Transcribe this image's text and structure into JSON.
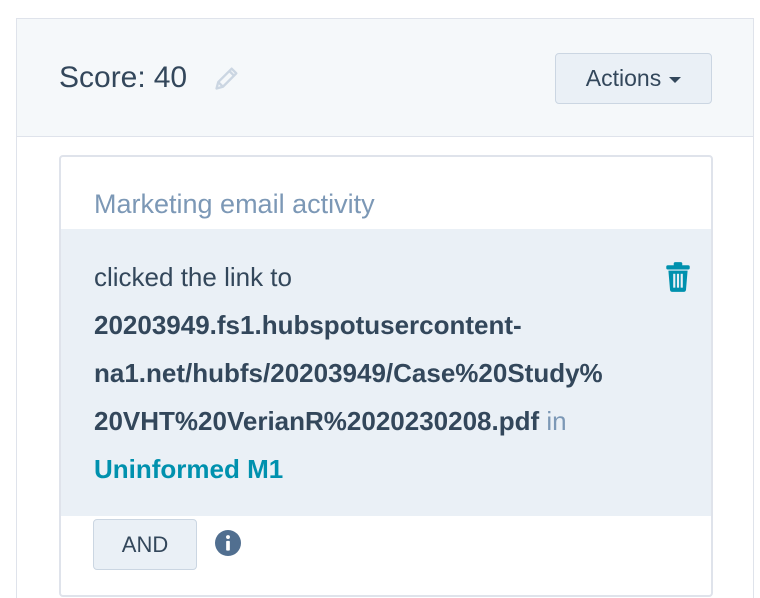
{
  "header": {
    "score_label": "Score:",
    "score_value": "40",
    "edit_icon": "pencil-icon",
    "actions_label": "Actions"
  },
  "filter": {
    "title": "Marketing email activity",
    "action_text": "clicked the link to",
    "url_lines": [
      "20203949.fs1.hubspotusercontent-",
      "na1.net/hubfs/20203949/Case%20Study%",
      "20VHT%20VerianR%2020230208.pdf"
    ],
    "in_word": "in",
    "email_name": "Uninformed M1",
    "delete_icon": "trash-icon",
    "and_label": "AND",
    "info_icon": "info-icon"
  },
  "colors": {
    "text": "#33475b",
    "muted": "#7c98b6",
    "link": "#0091ae",
    "header_bg": "#f5f8fa",
    "highlight_bg": "#eaf0f6",
    "border": "#dfe3eb"
  }
}
